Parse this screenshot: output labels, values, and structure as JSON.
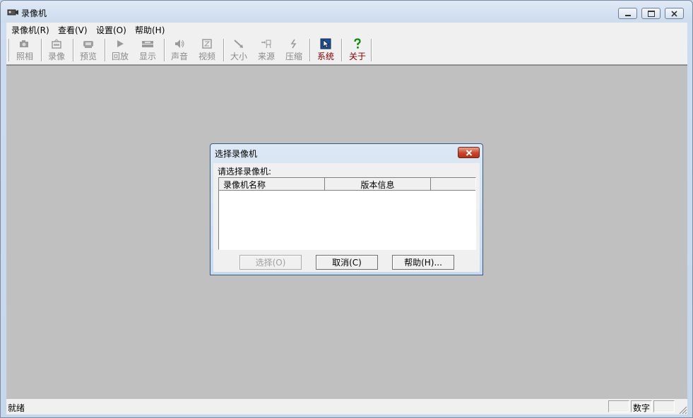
{
  "window": {
    "title": "录像机",
    "icons": {
      "app": "camcorder-icon",
      "minimize": "minimize-icon",
      "maximize": "maximize-icon",
      "close": "close-icon"
    }
  },
  "menu": [
    "录像机(R)",
    "查看(V)",
    "设置(O)",
    "帮助(H)"
  ],
  "toolbar": {
    "buttons": [
      {
        "label": "照相",
        "icon": "camera-icon",
        "enabled": false
      },
      {
        "label": "录像",
        "icon": "record-icon",
        "enabled": false
      },
      {
        "label": "预览",
        "icon": "preview-icon",
        "enabled": false
      },
      {
        "label": "回放",
        "icon": "play-icon",
        "enabled": false
      },
      {
        "label": "显示",
        "icon": "display-icon",
        "enabled": false
      },
      {
        "label": "声音",
        "icon": "speaker-icon",
        "enabled": false
      },
      {
        "label": "视频",
        "icon": "video-icon",
        "enabled": false
      },
      {
        "label": "大小",
        "icon": "resize-icon",
        "enabled": false
      },
      {
        "label": "来源",
        "icon": "source-icon",
        "enabled": false
      },
      {
        "label": "压缩",
        "icon": "compress-icon",
        "enabled": false
      },
      {
        "label": "系统",
        "icon": "system-icon",
        "enabled": true
      },
      {
        "label": "关于",
        "icon": "help-question-icon",
        "enabled": true
      }
    ]
  },
  "dialog": {
    "title": "选择录像机",
    "prompt": "请选择录像机:",
    "columns": [
      "录像机名称",
      "版本信息"
    ],
    "rows": [],
    "buttons": {
      "select": "选择(O)",
      "cancel": "取消(C)",
      "help": "帮助(H)..."
    }
  },
  "status": {
    "text": "就绪",
    "num_indicator": "数字"
  },
  "colors": {
    "disabled_label": "#8a8a8a",
    "active_label": "#800000",
    "client_bg": "#c0c0c0"
  }
}
